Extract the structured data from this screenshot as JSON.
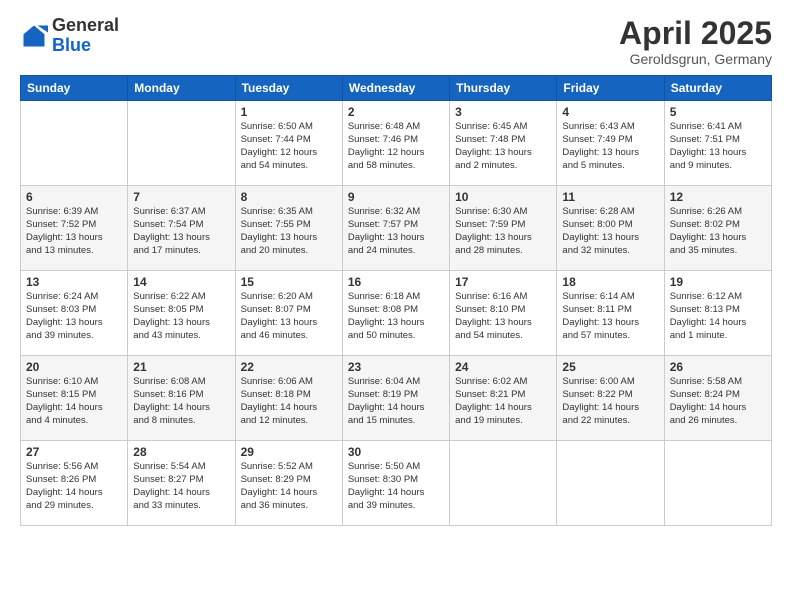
{
  "header": {
    "logo_general": "General",
    "logo_blue": "Blue",
    "title": "April 2025",
    "subtitle": "Geroldsgrun, Germany"
  },
  "weekdays": [
    "Sunday",
    "Monday",
    "Tuesday",
    "Wednesday",
    "Thursday",
    "Friday",
    "Saturday"
  ],
  "weeks": [
    [
      {
        "day": "",
        "info": ""
      },
      {
        "day": "",
        "info": ""
      },
      {
        "day": "1",
        "info": "Sunrise: 6:50 AM\nSunset: 7:44 PM\nDaylight: 12 hours\nand 54 minutes."
      },
      {
        "day": "2",
        "info": "Sunrise: 6:48 AM\nSunset: 7:46 PM\nDaylight: 12 hours\nand 58 minutes."
      },
      {
        "day": "3",
        "info": "Sunrise: 6:45 AM\nSunset: 7:48 PM\nDaylight: 13 hours\nand 2 minutes."
      },
      {
        "day": "4",
        "info": "Sunrise: 6:43 AM\nSunset: 7:49 PM\nDaylight: 13 hours\nand 5 minutes."
      },
      {
        "day": "5",
        "info": "Sunrise: 6:41 AM\nSunset: 7:51 PM\nDaylight: 13 hours\nand 9 minutes."
      }
    ],
    [
      {
        "day": "6",
        "info": "Sunrise: 6:39 AM\nSunset: 7:52 PM\nDaylight: 13 hours\nand 13 minutes."
      },
      {
        "day": "7",
        "info": "Sunrise: 6:37 AM\nSunset: 7:54 PM\nDaylight: 13 hours\nand 17 minutes."
      },
      {
        "day": "8",
        "info": "Sunrise: 6:35 AM\nSunset: 7:55 PM\nDaylight: 13 hours\nand 20 minutes."
      },
      {
        "day": "9",
        "info": "Sunrise: 6:32 AM\nSunset: 7:57 PM\nDaylight: 13 hours\nand 24 minutes."
      },
      {
        "day": "10",
        "info": "Sunrise: 6:30 AM\nSunset: 7:59 PM\nDaylight: 13 hours\nand 28 minutes."
      },
      {
        "day": "11",
        "info": "Sunrise: 6:28 AM\nSunset: 8:00 PM\nDaylight: 13 hours\nand 32 minutes."
      },
      {
        "day": "12",
        "info": "Sunrise: 6:26 AM\nSunset: 8:02 PM\nDaylight: 13 hours\nand 35 minutes."
      }
    ],
    [
      {
        "day": "13",
        "info": "Sunrise: 6:24 AM\nSunset: 8:03 PM\nDaylight: 13 hours\nand 39 minutes."
      },
      {
        "day": "14",
        "info": "Sunrise: 6:22 AM\nSunset: 8:05 PM\nDaylight: 13 hours\nand 43 minutes."
      },
      {
        "day": "15",
        "info": "Sunrise: 6:20 AM\nSunset: 8:07 PM\nDaylight: 13 hours\nand 46 minutes."
      },
      {
        "day": "16",
        "info": "Sunrise: 6:18 AM\nSunset: 8:08 PM\nDaylight: 13 hours\nand 50 minutes."
      },
      {
        "day": "17",
        "info": "Sunrise: 6:16 AM\nSunset: 8:10 PM\nDaylight: 13 hours\nand 54 minutes."
      },
      {
        "day": "18",
        "info": "Sunrise: 6:14 AM\nSunset: 8:11 PM\nDaylight: 13 hours\nand 57 minutes."
      },
      {
        "day": "19",
        "info": "Sunrise: 6:12 AM\nSunset: 8:13 PM\nDaylight: 14 hours\nand 1 minute."
      }
    ],
    [
      {
        "day": "20",
        "info": "Sunrise: 6:10 AM\nSunset: 8:15 PM\nDaylight: 14 hours\nand 4 minutes."
      },
      {
        "day": "21",
        "info": "Sunrise: 6:08 AM\nSunset: 8:16 PM\nDaylight: 14 hours\nand 8 minutes."
      },
      {
        "day": "22",
        "info": "Sunrise: 6:06 AM\nSunset: 8:18 PM\nDaylight: 14 hours\nand 12 minutes."
      },
      {
        "day": "23",
        "info": "Sunrise: 6:04 AM\nSunset: 8:19 PM\nDaylight: 14 hours\nand 15 minutes."
      },
      {
        "day": "24",
        "info": "Sunrise: 6:02 AM\nSunset: 8:21 PM\nDaylight: 14 hours\nand 19 minutes."
      },
      {
        "day": "25",
        "info": "Sunrise: 6:00 AM\nSunset: 8:22 PM\nDaylight: 14 hours\nand 22 minutes."
      },
      {
        "day": "26",
        "info": "Sunrise: 5:58 AM\nSunset: 8:24 PM\nDaylight: 14 hours\nand 26 minutes."
      }
    ],
    [
      {
        "day": "27",
        "info": "Sunrise: 5:56 AM\nSunset: 8:26 PM\nDaylight: 14 hours\nand 29 minutes."
      },
      {
        "day": "28",
        "info": "Sunrise: 5:54 AM\nSunset: 8:27 PM\nDaylight: 14 hours\nand 33 minutes."
      },
      {
        "day": "29",
        "info": "Sunrise: 5:52 AM\nSunset: 8:29 PM\nDaylight: 14 hours\nand 36 minutes."
      },
      {
        "day": "30",
        "info": "Sunrise: 5:50 AM\nSunset: 8:30 PM\nDaylight: 14 hours\nand 39 minutes."
      },
      {
        "day": "",
        "info": ""
      },
      {
        "day": "",
        "info": ""
      },
      {
        "day": "",
        "info": ""
      }
    ]
  ]
}
